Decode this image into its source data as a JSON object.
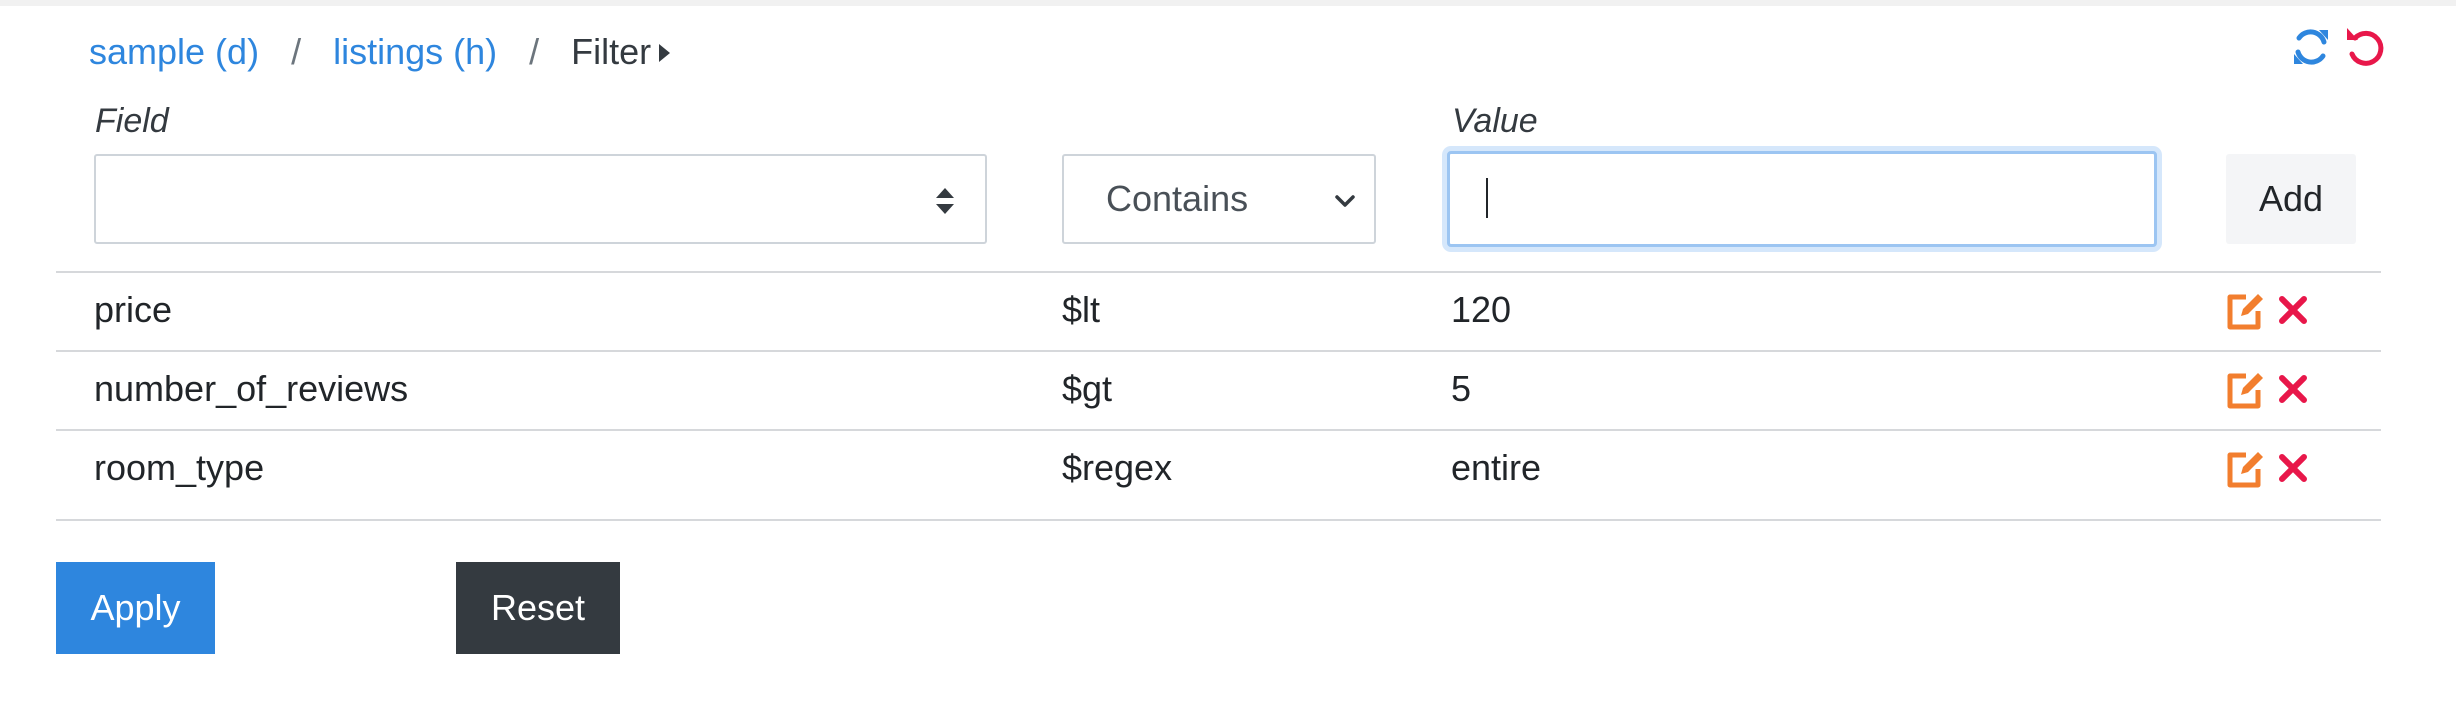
{
  "breadcrumb": {
    "items": [
      {
        "label": "sample (d)"
      },
      {
        "label": "listings (h)"
      }
    ],
    "separator": "/",
    "current": "Filter"
  },
  "toolbar": {
    "icons": [
      "refresh-icon",
      "undo-icon"
    ],
    "colors": {
      "refresh": "#2e86de",
      "undo": "#e8174a"
    }
  },
  "form": {
    "field_label": "Field",
    "field_value": "",
    "operator_value": "Contains",
    "value_label": "Value",
    "value_value": "",
    "add_label": "Add"
  },
  "filters": [
    {
      "field": "price",
      "operator": "$lt",
      "value": "120"
    },
    {
      "field": "number_of_reviews",
      "operator": "$gt",
      "value": "5"
    },
    {
      "field": "room_type",
      "operator": "$regex",
      "value": "entire"
    }
  ],
  "row_action_icons": [
    "edit-icon",
    "delete-icon"
  ],
  "colors": {
    "accent": "#2e86de",
    "edit": "#f27e2e",
    "delete": "#e8174a",
    "dark": "#343a40"
  },
  "actions": {
    "apply_label": "Apply",
    "reset_label": "Reset"
  }
}
